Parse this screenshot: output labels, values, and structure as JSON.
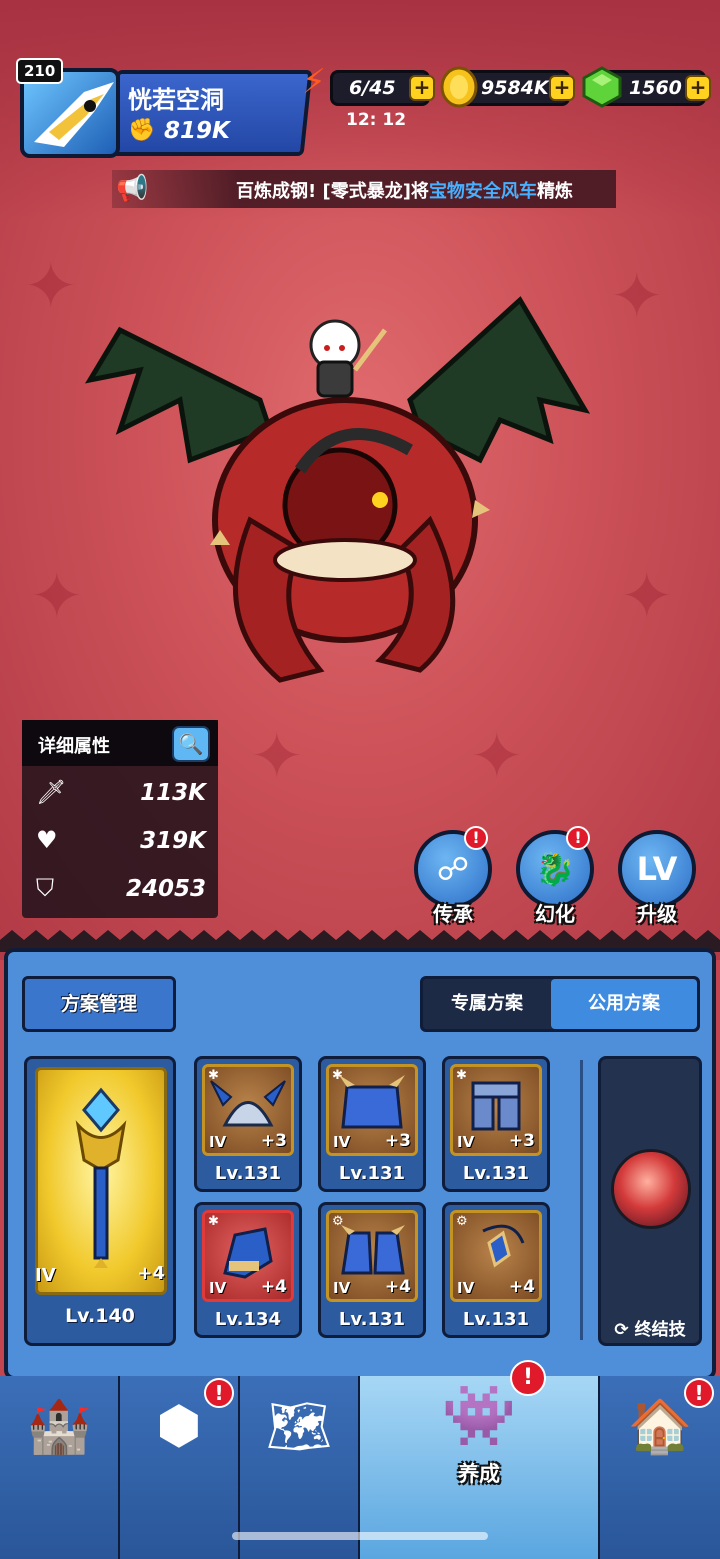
{
  "player": {
    "level": "210",
    "name": "恍若空洞",
    "power": "819K"
  },
  "resources": {
    "energy": "6/45",
    "energy_timer": "12: 12",
    "gold": "9584K",
    "gems": "1560",
    "plus_label": "+"
  },
  "ticker": {
    "prefix": "百炼成钢! [零式暴龙]将",
    "highlight": "宝物安全风车",
    "suffix": "精炼"
  },
  "stats": {
    "title": "详细属性",
    "attack": "113K",
    "hp": "319K",
    "defense": "24053"
  },
  "actions": [
    {
      "label": "传承",
      "icon": "share-icon",
      "badge": "!"
    },
    {
      "label": "幻化",
      "icon": "dragon-morph-icon",
      "badge": "!"
    },
    {
      "label": "升级",
      "icon": "level-up-icon",
      "top_text": "LV"
    }
  ],
  "panel": {
    "plan_manage": "方案管理",
    "tab_exclusive": "专属方案",
    "tab_public": "公用方案",
    "active_tab": "tab_public",
    "weapon": {
      "tier": "IV",
      "plus": "+4",
      "level": "Lv.140"
    },
    "equipment": [
      {
        "tier": "IV",
        "plus": "+3",
        "level": "Lv.131",
        "icon": "horned-helmet-icon"
      },
      {
        "tier": "IV",
        "plus": "+3",
        "level": "Lv.131",
        "icon": "spiked-armor-icon"
      },
      {
        "tier": "IV",
        "plus": "+3",
        "level": "Lv.131",
        "icon": "leg-armor-icon"
      },
      {
        "tier": "IV",
        "plus": "+4",
        "level": "Lv.134",
        "icon": "gauntlet-icon"
      },
      {
        "tier": "IV",
        "plus": "+4",
        "level": "Lv.131",
        "icon": "spiked-boots-icon"
      },
      {
        "tier": "IV",
        "plus": "+4",
        "level": "Lv.131",
        "icon": "amulet-icon"
      }
    ],
    "finisher": "终结技"
  },
  "nav": [
    {
      "label": "",
      "icon": "crystal-castle-icon"
    },
    {
      "label": "",
      "icon": "rune-upgrade-icon",
      "badge": "!"
    },
    {
      "label": "",
      "icon": "treasure-map-icon"
    },
    {
      "label": "养成",
      "icon": "character-cultivate-icon",
      "badge": "!"
    },
    {
      "label": "",
      "icon": "guild-house-icon",
      "badge": "!"
    }
  ],
  "colors": {
    "accent_blue": "#4f8fd9",
    "bg_red": "#c2454f",
    "gold": "#ffd21f",
    "badge_red": "#e01a2a",
    "ticker_highlight": "#47b0ff"
  }
}
